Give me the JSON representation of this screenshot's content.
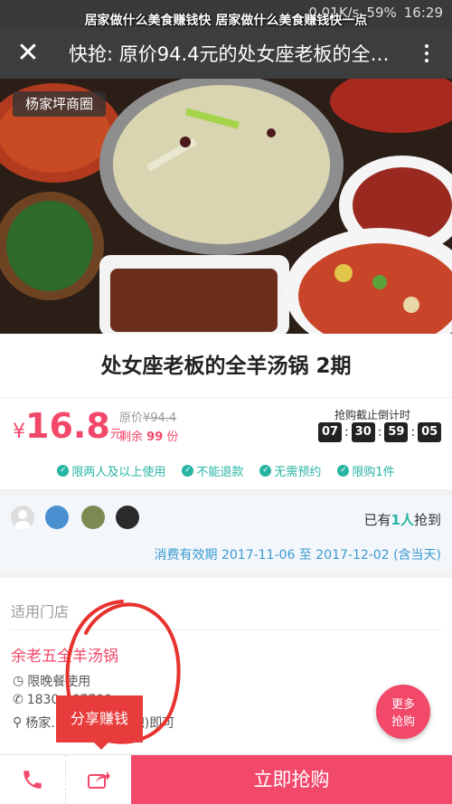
{
  "status_bar": {
    "overlay_text": "居家做什么美食赚钱快 居家做什么美食赚钱快一点",
    "speed": "0.01K/s",
    "battery": "59%",
    "time": "16:29"
  },
  "header": {
    "close_symbol": "✕",
    "title": "快抢: 原价94.4元的处女座老板的全羊…"
  },
  "hero": {
    "district_tag": "杨家坪商圈"
  },
  "deal": {
    "title": "处女座老板的全羊汤锅 2期",
    "currency": "¥",
    "price": "16.8",
    "price_unit": "元",
    "original_label": "原价",
    "original_price": "¥94.4",
    "remain_prefix": "剩余",
    "remain_count": "99",
    "remain_suffix": "份",
    "countdown_label": "抢购截止倒计时",
    "countdown": [
      "07",
      "30",
      "59",
      "05"
    ],
    "tags": [
      "限两人及以上使用",
      "不能退款",
      "无需预约",
      "限购1件"
    ]
  },
  "buyers": {
    "prefix": "已有",
    "count": "1人",
    "suffix": "抢到",
    "validity": "消费有效期 2017-11-06 至 2017-12-02 (含当天)"
  },
  "stores": {
    "title": "适用门店",
    "name": "余老五全羊汤锅",
    "hours": "限晚餐使用",
    "phone": "1830…67700",
    "address": "杨家…导航(可鲁网吧)即可"
  },
  "floating": {
    "more_line1": "更多",
    "more_line2": "抢购",
    "share_tip": "分享赚钱"
  },
  "bottom": {
    "buy_label": "立即抢购"
  },
  "colors": {
    "accent": "#f2486a",
    "teal": "#27b5a3",
    "link": "#3a9bd0"
  }
}
